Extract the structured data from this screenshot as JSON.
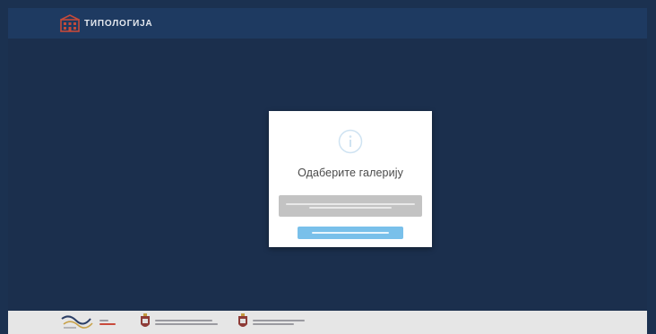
{
  "app": {
    "brand_name": "ТИПОЛОГИЈА"
  },
  "modal": {
    "title": "Одаберите галерију",
    "icon": "info-icon",
    "gallery_option_label": "",
    "confirm_label": ""
  },
  "colors": {
    "background": "#1c3254",
    "topbar": "#1e3a61",
    "modal_background": "#ffffff",
    "select_background": "#c3c3c3",
    "confirm_button": "#79c0ea",
    "footer": "#e6e6e6"
  },
  "footer": {
    "partners": [
      {
        "icon": "partner-logo-wave-icon"
      },
      {
        "icon": "coat-of-arms-icon"
      },
      {
        "icon": "coat-of-arms-icon"
      }
    ]
  }
}
